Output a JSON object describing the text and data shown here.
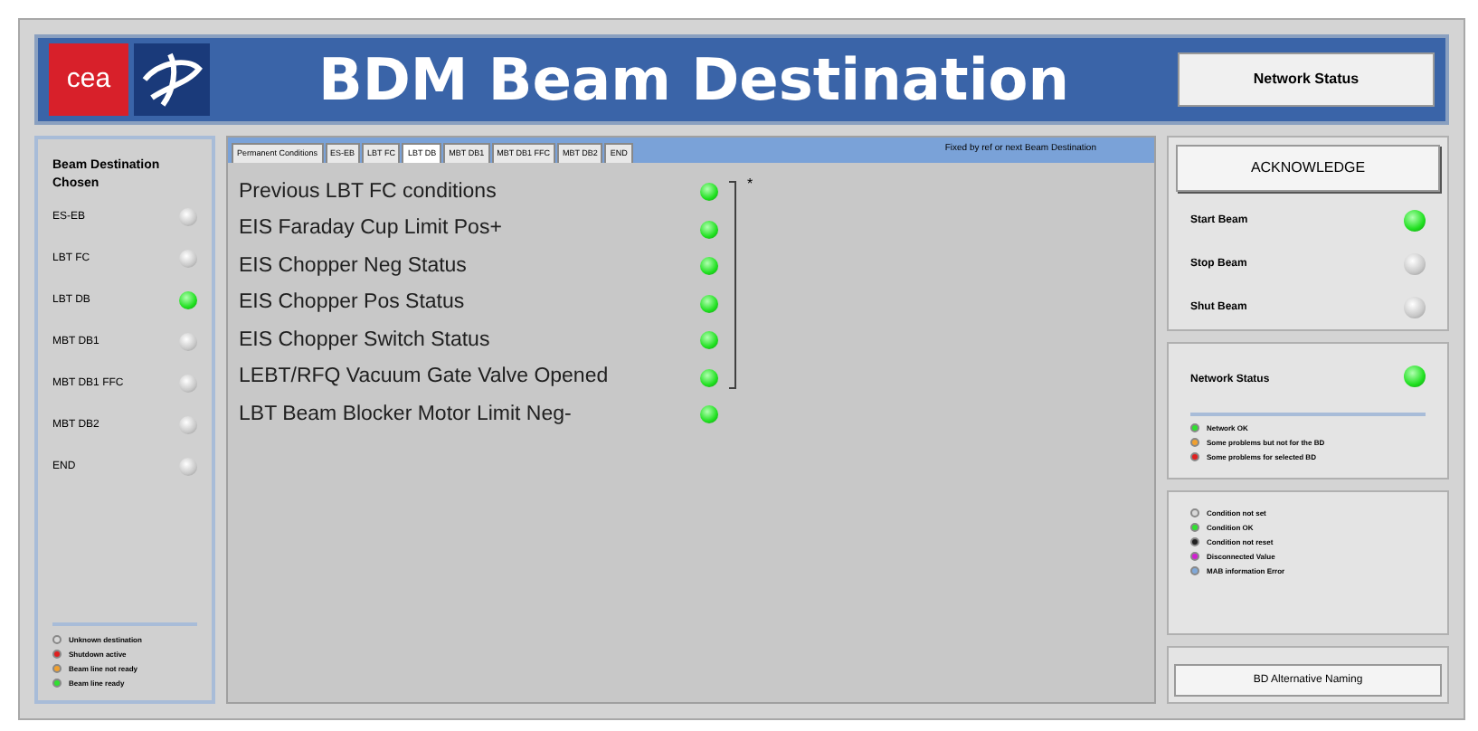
{
  "header": {
    "title": "BDM Beam Destination",
    "logo_text": "cea",
    "network_button": "Network Status"
  },
  "destinations": {
    "title": "Beam Destination Chosen",
    "items": [
      {
        "label": "ES-EB",
        "on": false
      },
      {
        "label": "LBT FC",
        "on": false
      },
      {
        "label": "LBT DB",
        "on": true
      },
      {
        "label": "MBT DB1",
        "on": false
      },
      {
        "label": "MBT DB1 FFC",
        "on": false
      },
      {
        "label": "MBT DB2",
        "on": false
      },
      {
        "label": "END",
        "on": false
      }
    ],
    "legend": [
      {
        "label": "Unknown destination",
        "color": "#d8d8d8"
      },
      {
        "label": "Shutdown active",
        "color": "#e02020"
      },
      {
        "label": "Beam line not ready",
        "color": "#f0a030"
      },
      {
        "label": "Beam line ready",
        "color": "#30e030"
      }
    ]
  },
  "tabs": [
    {
      "label": "Permanent Conditions",
      "selected": false
    },
    {
      "label": "ES-EB",
      "selected": false
    },
    {
      "label": "LBT FC",
      "selected": false
    },
    {
      "label": "LBT DB",
      "selected": true
    },
    {
      "label": "MBT DB1",
      "selected": false
    },
    {
      "label": "MBT DB1 FFC",
      "selected": false
    },
    {
      "label": "MBT DB2",
      "selected": false
    },
    {
      "label": "END",
      "selected": false
    }
  ],
  "tab_note": "Fixed by ref or next Beam Destination",
  "conditions": [
    {
      "label": "Previous LBT FC conditions",
      "on": true,
      "bracketed": true
    },
    {
      "label": "EIS Faraday Cup Limit Pos+",
      "on": true,
      "bracketed": true
    },
    {
      "label": "EIS Chopper Neg Status",
      "on": true,
      "bracketed": true
    },
    {
      "label": "EIS Chopper Pos Status",
      "on": true,
      "bracketed": true
    },
    {
      "label": "EIS Chopper Switch Status",
      "on": true,
      "bracketed": true
    },
    {
      "label": "LEBT/RFQ Vacuum Gate Valve Opened",
      "on": true,
      "bracketed": true
    },
    {
      "label": "LBT Beam Blocker Motor Limit Neg-",
      "on": true,
      "bracketed": false
    }
  ],
  "bracket_mark": "*",
  "acknowledge": "ACKNOWLEDGE",
  "beam_controls": [
    {
      "label": "Start Beam",
      "on": true
    },
    {
      "label": "Stop Beam",
      "on": false
    },
    {
      "label": "Shut Beam",
      "on": false
    }
  ],
  "network": {
    "label": "Network Status",
    "on": true,
    "legend": [
      {
        "label": "Network OK",
        "color": "#30e030"
      },
      {
        "label": "Some problems but not for the BD",
        "color": "#f0a030"
      },
      {
        "label": "Some problems for selected BD",
        "color": "#e02020"
      }
    ]
  },
  "condition_legend": [
    {
      "label": "Condition not set",
      "color": "#d8d8d8"
    },
    {
      "label": "Condition OK",
      "color": "#30e030"
    },
    {
      "label": "Condition not reset",
      "color": "#202020"
    },
    {
      "label": "Disconnected Value",
      "color": "#d020d0"
    },
    {
      "label": "MAB information Error",
      "color": "#80a8d8"
    }
  ],
  "alt_button": "BD Alternative Naming"
}
